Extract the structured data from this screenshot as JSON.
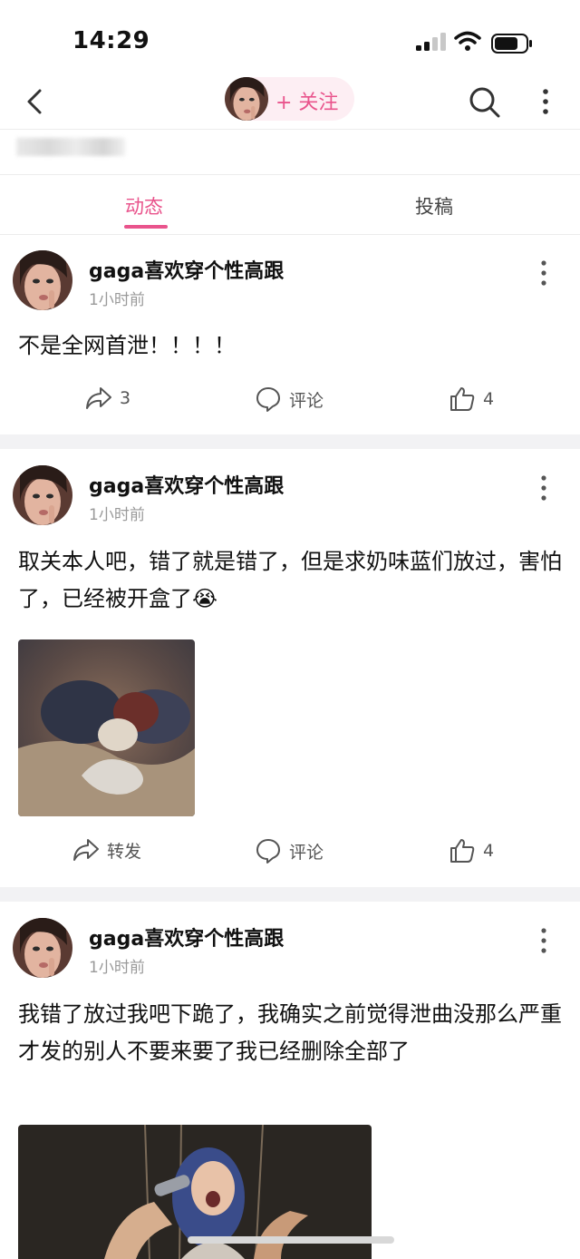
{
  "status_bar": {
    "time": "14:29"
  },
  "header": {
    "follow_label": "+ 关注"
  },
  "tabs": [
    {
      "label": "动态",
      "active": true
    },
    {
      "label": "投稿",
      "active": false
    }
  ],
  "colors": {
    "accent": "#e9548c",
    "pill_bg": "#fdeef3",
    "separator": "#f2f2f4"
  },
  "posts": [
    {
      "username": "gaga喜欢穿个性高跟",
      "time": "1小时前",
      "text": "不是全网首泄！！！！",
      "share": "3",
      "comment": "评论",
      "like": "4"
    },
    {
      "username": "gaga喜欢穿个性高跟",
      "time": "1小时前",
      "text": "取关本人吧，错了就是错了，但是求奶味蓝们放过，害怕了，已经被开盒了",
      "emoji": "😭",
      "share": "转发",
      "comment": "评论",
      "like": "4"
    },
    {
      "username": "gaga喜欢穿个性高跟",
      "time": "1小时前",
      "text": "我错了放过我吧下跪了，我确实之前觉得泄曲没那么严重才发的别人不要来要了我已经删除全部了"
    }
  ],
  "icons": [
    "back-icon",
    "search-icon",
    "more-icon",
    "share-icon",
    "comment-icon",
    "like-icon"
  ]
}
